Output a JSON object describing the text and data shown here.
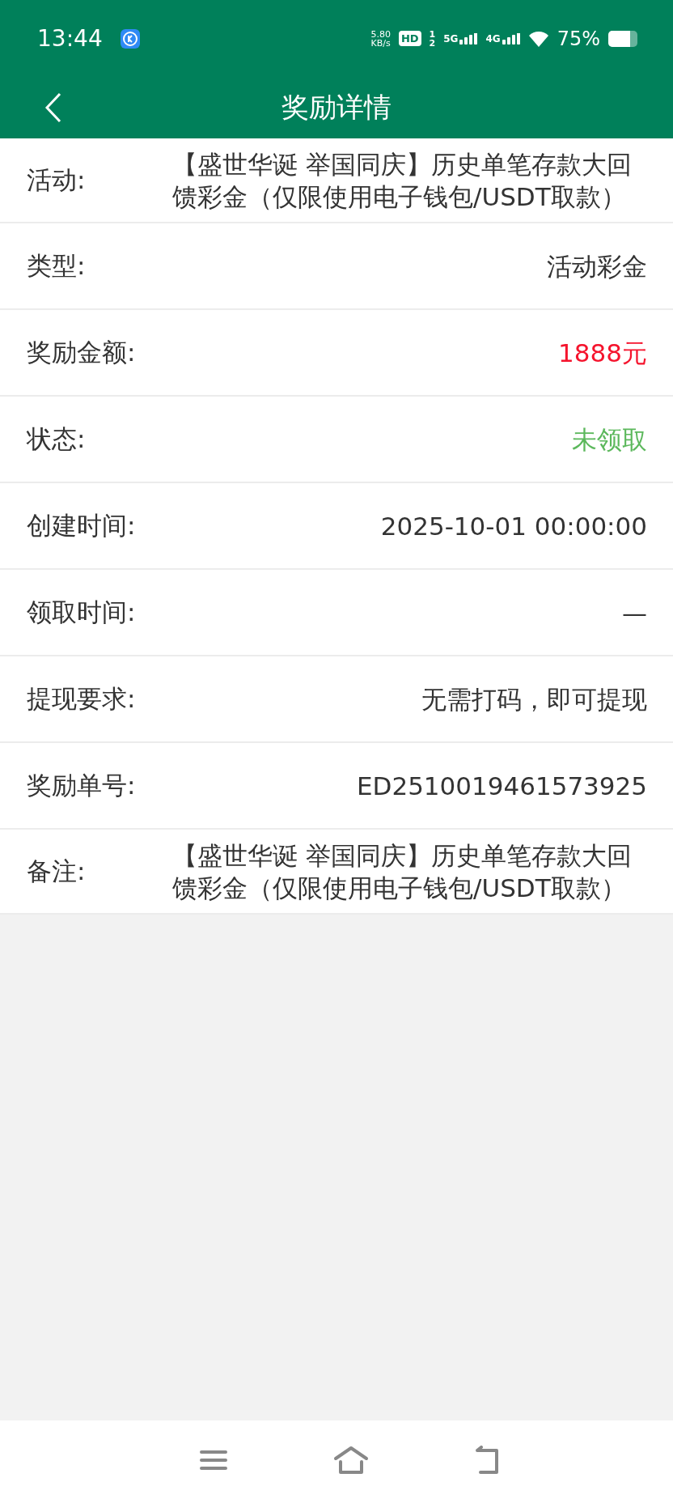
{
  "status_bar": {
    "time": "13:44",
    "net_speed": "5.80",
    "net_unit": "KB/s",
    "hd": "HD",
    "hd_sup": "1",
    "hd_sub": "2",
    "sim1": "5G",
    "sim2": "4G",
    "battery": "75%"
  },
  "header": {
    "title": "奖励详情"
  },
  "rows": [
    {
      "label": "活动:",
      "value": "【盛世华诞 举国同庆】历史单笔存款大回馈彩金（仅限使用电子钱包/USDT取款）",
      "kind": "long"
    },
    {
      "label": "类型:",
      "value": "活动彩金",
      "kind": "plain"
    },
    {
      "label": "奖励金额:",
      "value": "1888元",
      "kind": "amount"
    },
    {
      "label": "状态:",
      "value": "未领取",
      "kind": "status"
    },
    {
      "label": "创建时间:",
      "value": "2025-10-01 00:00:00",
      "kind": "plain"
    },
    {
      "label": "领取时间:",
      "value": "—",
      "kind": "plain"
    },
    {
      "label": "提现要求:",
      "value": "无需打码，即可提现",
      "kind": "plain"
    },
    {
      "label": "奖励单号:",
      "value": "ED2510019461573925",
      "kind": "plain"
    },
    {
      "label": "备注:",
      "value": "【盛世华诞 举国同庆】历史单笔存款大回馈彩金（仅限使用电子钱包/USDT取款）",
      "kind": "long"
    }
  ]
}
